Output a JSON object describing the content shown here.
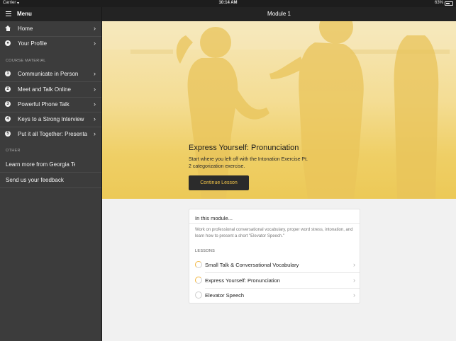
{
  "status_bar": {
    "carrier": "Carrier",
    "time": "10:14 AM",
    "battery": "63%",
    "battery_level": 0.63
  },
  "sidebar": {
    "title": "Menu",
    "top_items": [
      {
        "label": "Home",
        "icon": "home-icon"
      },
      {
        "label": "Your Profile",
        "icon": "profile-icon"
      }
    ],
    "course_section": "COURSE MATERIAL",
    "course_items": [
      {
        "label": "Communicate in Person",
        "icon_text": "1"
      },
      {
        "label": "Meet and Talk Online",
        "icon_text": "2"
      },
      {
        "label": "Powerful Phone Talk",
        "icon_text": "3"
      },
      {
        "label": "Keys to a Strong Interview",
        "icon_text": "4"
      },
      {
        "label": "Put it all Together: Presentations",
        "icon_text": "5"
      }
    ],
    "other_section": "OTHER",
    "other_items": [
      {
        "label": "Learn more from Georgia Tech"
      },
      {
        "label": "Send us your feedback"
      }
    ]
  },
  "main": {
    "title": "Module 1",
    "hero": {
      "title": "Express Yourself: Pronunciation",
      "description": "Start where you left off with the Intonation Exercise Pt. 2 categorization exercise.",
      "button": "Continue Lesson"
    },
    "module_card": {
      "heading": "In this module...",
      "description": "Work on professional conversational vocabulary, proper word stress, intonation, and learn how to present a short \"Elevator Speech.\"",
      "lessons_heading": "LESSONS",
      "lessons": [
        {
          "name": "Small Talk & Conversational Vocabulary",
          "status": "in-progress"
        },
        {
          "name": "Express Yourself: Pronunciation",
          "status": "in-progress"
        },
        {
          "name": "Elevator Speech",
          "status": "not-started"
        }
      ]
    }
  },
  "colors": {
    "accent": "#F3C548",
    "sidebar_bg": "#3C3C3C",
    "navbar_bg": "#232323"
  }
}
